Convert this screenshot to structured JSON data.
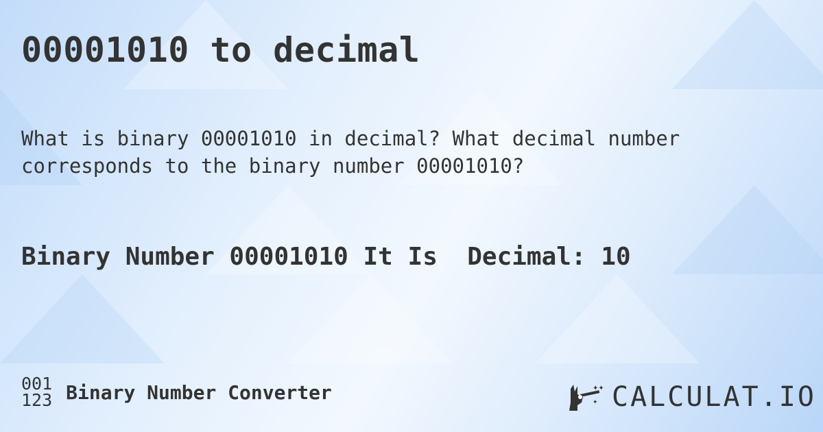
{
  "header": {
    "title": "00001010 to decimal"
  },
  "question": {
    "text": "What is binary 00001010 in decimal? What decimal number corresponds to the binary number 00001010?"
  },
  "answer": {
    "text": "Binary Number 00001010 It Is  Decimal: 10"
  },
  "footer": {
    "icon_top": "001",
    "icon_bottom": "123",
    "label": "Binary Number Converter",
    "logo_text": "CALCULAT.IO"
  },
  "colors": {
    "text": "#333333",
    "bg_light": "#f2f8fe",
    "bg_blue": "#b9d6f8"
  }
}
